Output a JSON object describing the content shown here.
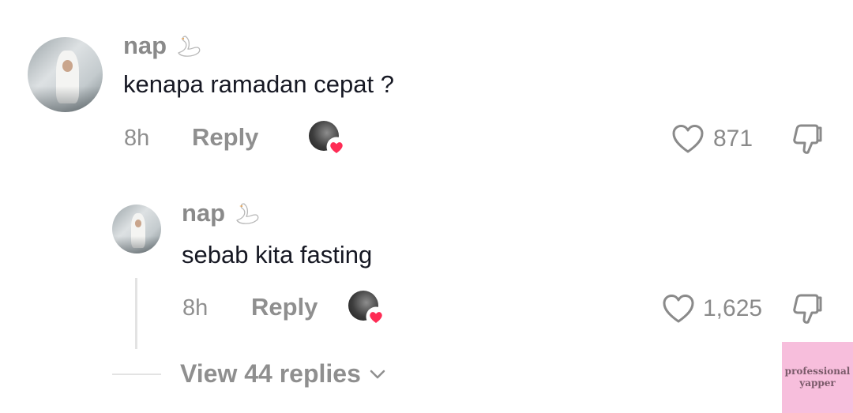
{
  "comment": {
    "username": "nap",
    "user_badge_icon": "swan-icon",
    "text": "kenapa ramadan cepat ?",
    "time": "8h",
    "reply_label": "Reply",
    "like_count": "871"
  },
  "reply": {
    "username": "nap",
    "user_badge_icon": "swan-icon",
    "text": "sebab kita fasting",
    "time": "8h",
    "reply_label": "Reply",
    "like_count": "1,625"
  },
  "view_replies_label": "View 44 replies",
  "watermark": {
    "line1": "professional",
    "line2": "yapper"
  },
  "colors": {
    "heart_red": "#fe2c55",
    "muted_gray": "#8f8f8f",
    "text_dark": "#161823",
    "watermark_pink": "#f7bedc"
  }
}
